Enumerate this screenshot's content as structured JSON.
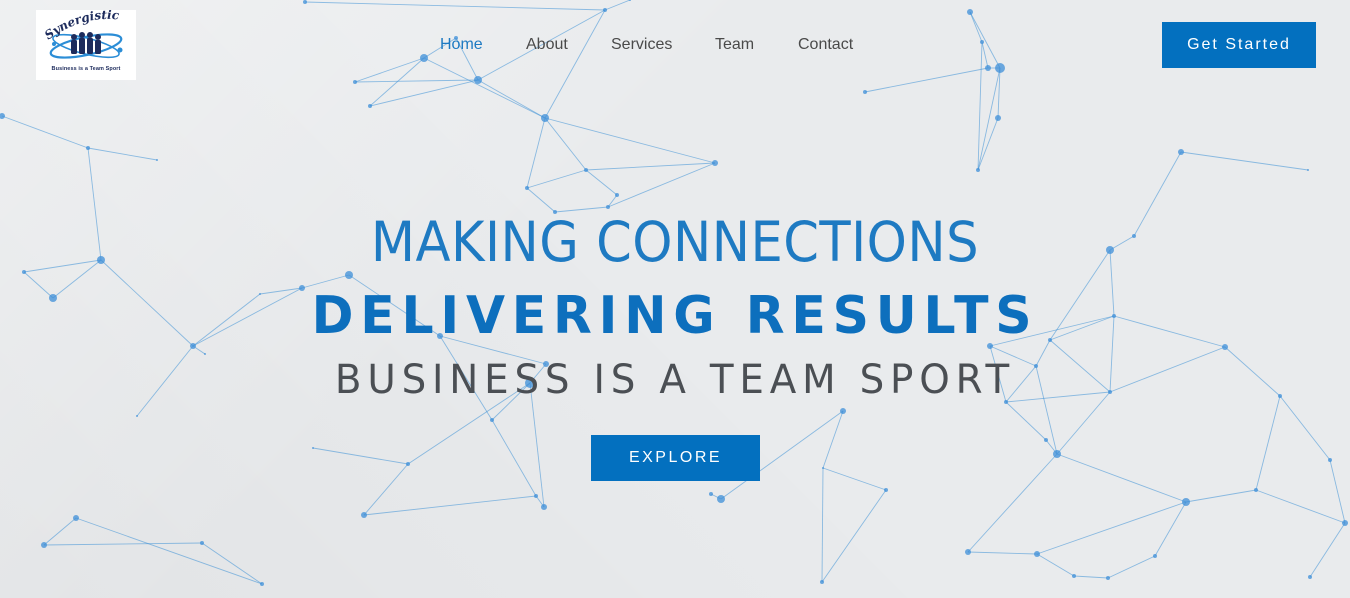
{
  "logo": {
    "wordmark": "Synergistic",
    "tagline": "Business is a Team Sport"
  },
  "nav": {
    "items": [
      {
        "label": "Home",
        "active": true
      },
      {
        "label": "About",
        "active": false
      },
      {
        "label": "Services",
        "active": false
      },
      {
        "label": "Team",
        "active": false
      },
      {
        "label": "Contact",
        "active": false
      }
    ]
  },
  "header": {
    "cta_label": "Get Started"
  },
  "hero": {
    "line1": "MAKING CONNECTIONS",
    "line2": "DELIVERING RESULTS",
    "line3": "BUSINESS IS A TEAM SPORT",
    "button_label": "EXPLORE"
  },
  "colors": {
    "accent": "#0370bf",
    "headline_light": "#1e7ac2",
    "headline_dark": "#0d6fbd",
    "subtitle": "#4b4f54",
    "nav_text": "#4a4a4a",
    "network_line": "#3a8fd6",
    "network_node": "#3d8fd8",
    "background": "#e9ebed"
  },
  "icons": {
    "logo_mark": "team-orbit-logo-icon",
    "background": "network-connections-pattern"
  }
}
